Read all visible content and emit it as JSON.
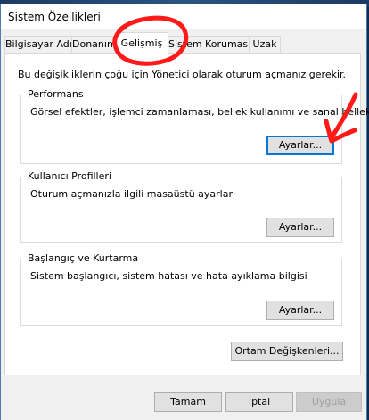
{
  "window": {
    "title": "Sistem Özellikleri"
  },
  "tabs": [
    {
      "label": "Bilgisayar Adı"
    },
    {
      "label": "Donanım"
    },
    {
      "label": "Gelişmiş"
    },
    {
      "label": "Sistem Koruması"
    },
    {
      "label": "Uzak"
    }
  ],
  "active_tab": "Gelişmiş",
  "advanced": {
    "note": "Bu değişikliklerin çoğu için Yönetici olarak oturum açmanız gerekir.",
    "groups": [
      {
        "title": "Performans",
        "description": "Görsel efektler, işlemci zamanlaması, bellek kullanımı ve sanal bellek",
        "button": "Ayarlar..."
      },
      {
        "title": "Kullanıcı Profilleri",
        "description": "Oturum açmanızla ilgili masaüstü ayarları",
        "button": "Ayarlar..."
      },
      {
        "title": "Başlangıç ve Kurtarma",
        "description": "Sistem başlangıcı, sistem hatası ve hata ayıklama bilgisi",
        "button": "Ayarlar..."
      }
    ],
    "env_button": "Ortam Değişkenleri..."
  },
  "footer": {
    "ok": "Tamam",
    "cancel": "İptal",
    "apply": "Uygula"
  },
  "colors": {
    "annotation": "#ff1a1a",
    "accent": "#0078d7"
  }
}
